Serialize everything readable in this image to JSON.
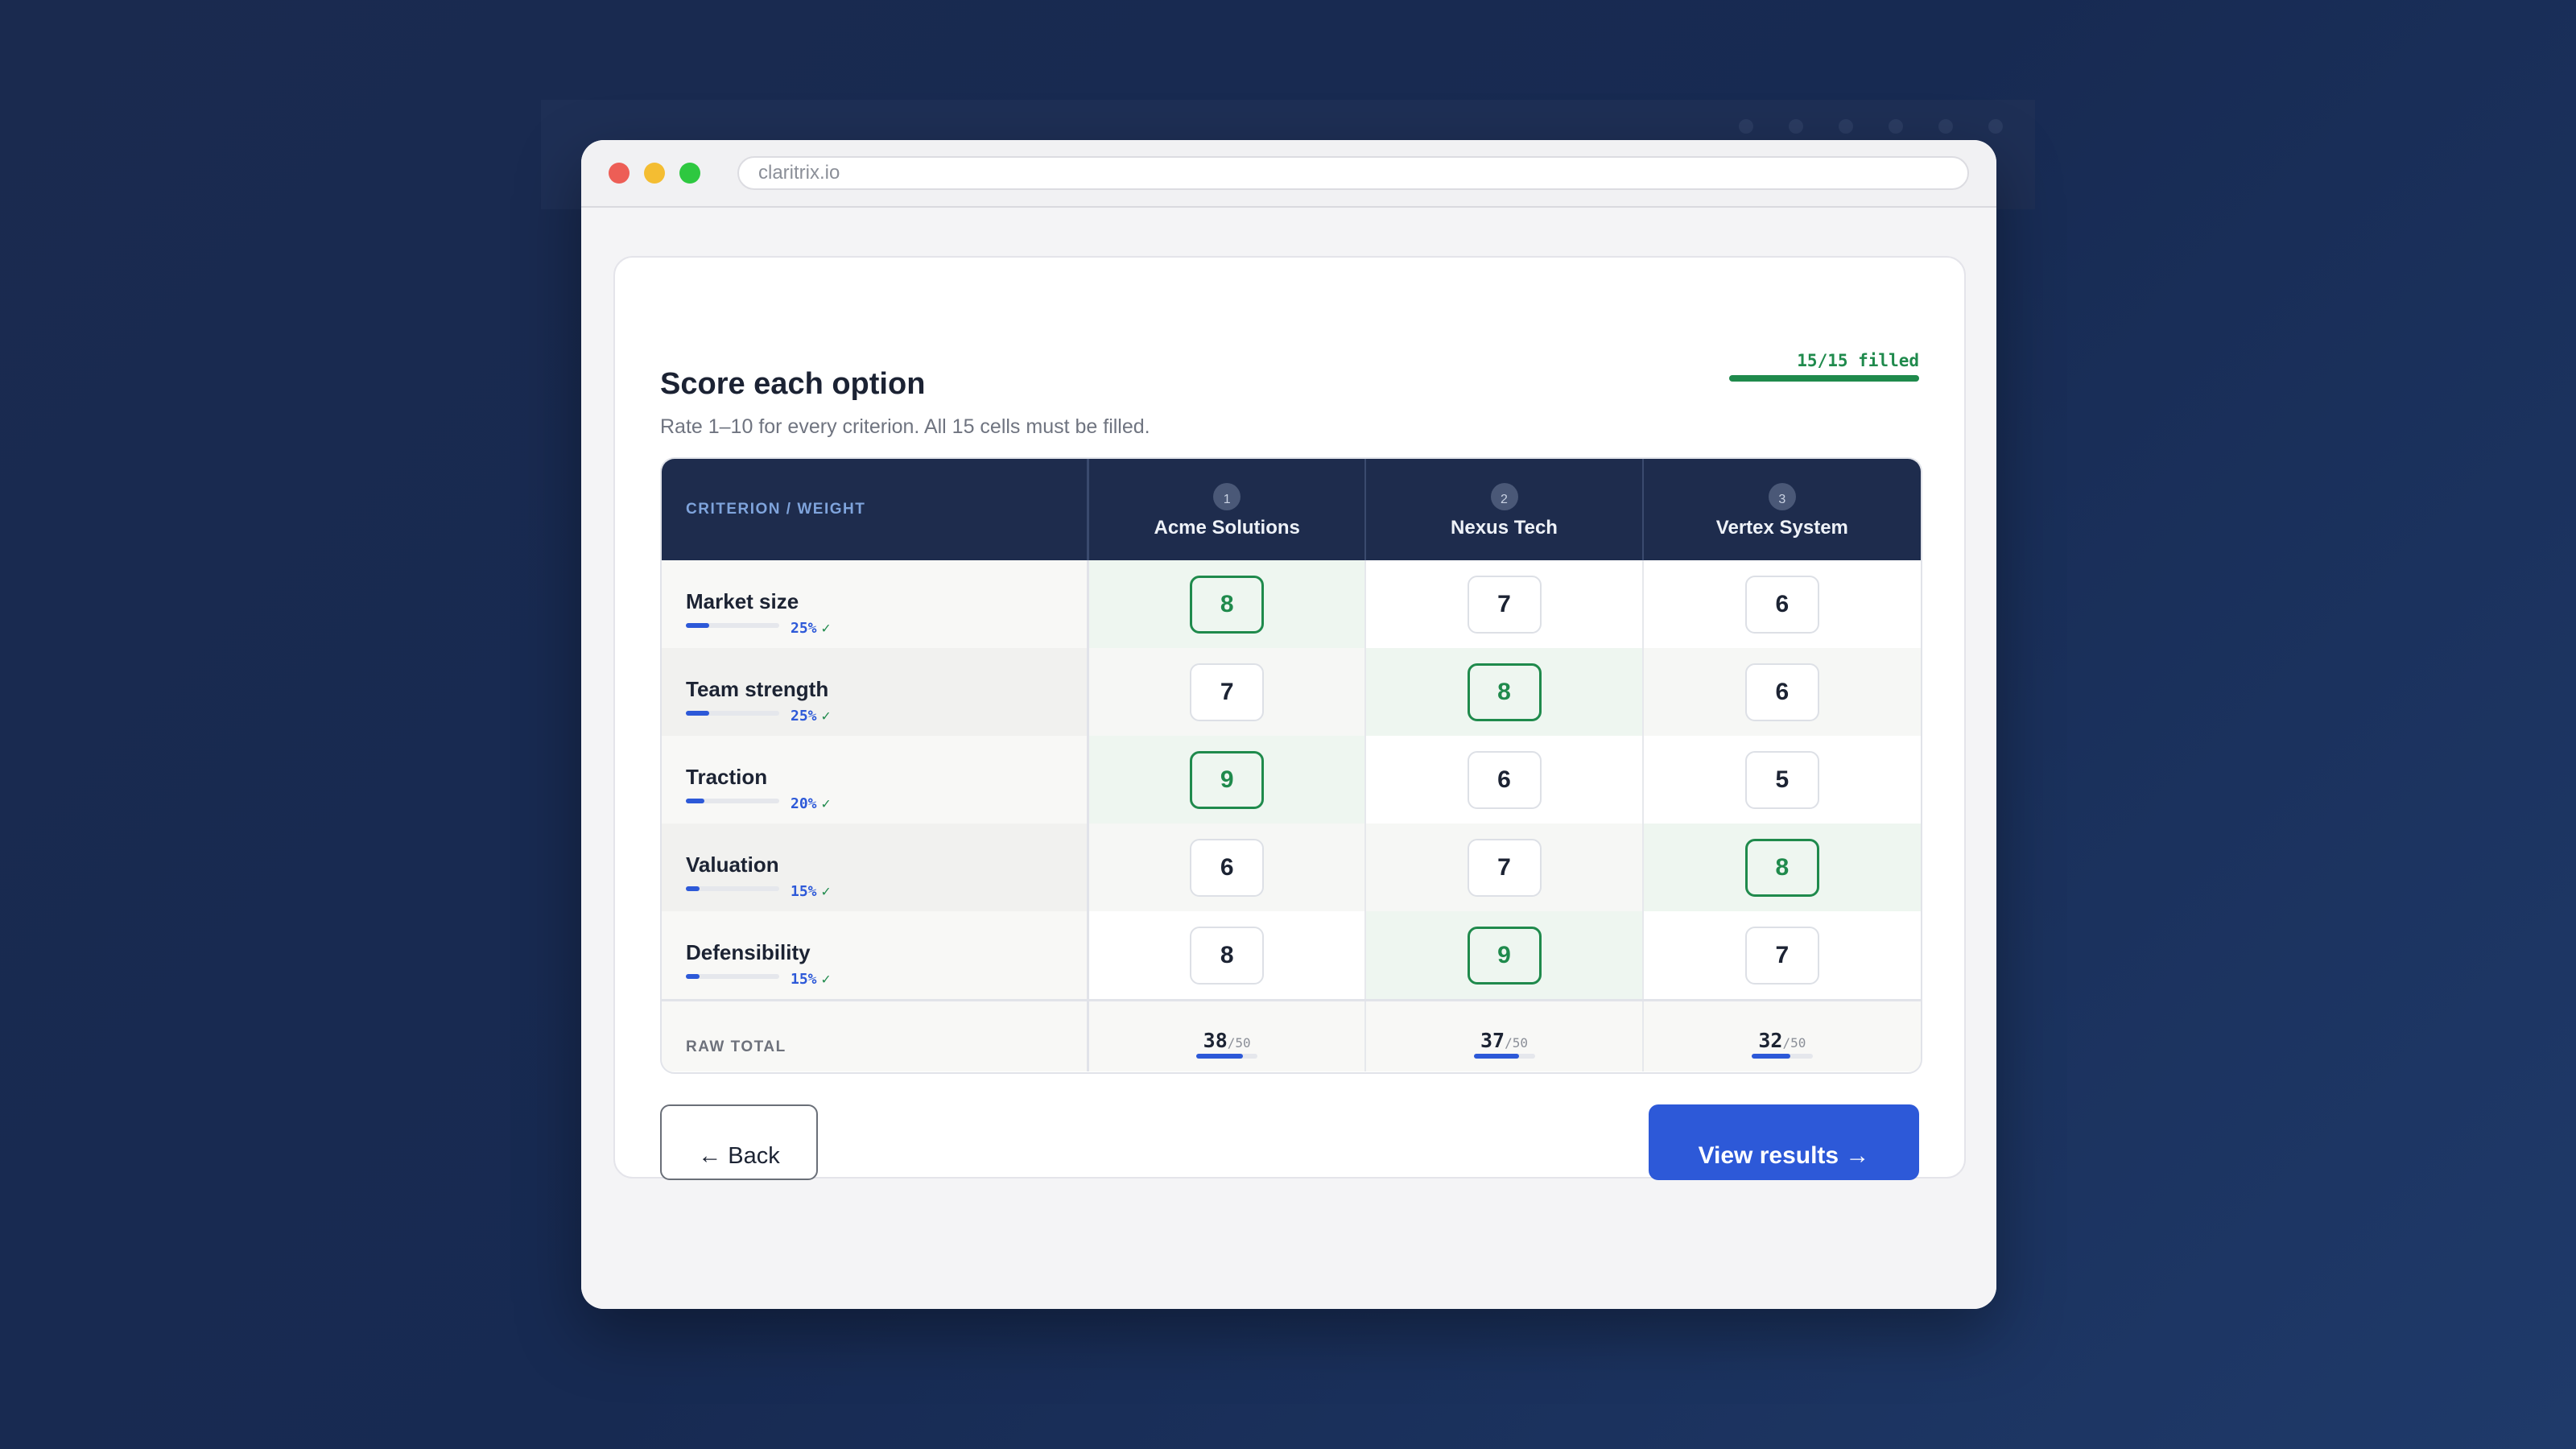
{
  "browser": {
    "url": "claritrix.io"
  },
  "page": {
    "title": "Score each option",
    "subtitle": "Rate 1–10 for every criterion. All 15 cells must be filled.",
    "progress": {
      "label": "15/15 filled",
      "fraction": 1.0
    }
  },
  "table": {
    "criterion_header": "CRITERION / WEIGHT",
    "options": [
      {
        "number": "1",
        "name": "Acme Solutions"
      },
      {
        "number": "2",
        "name": "Nexus Tech"
      },
      {
        "number": "3",
        "name": "Vertex System"
      }
    ],
    "criteria": [
      {
        "name": "Market size",
        "weight_label": "25%",
        "weight": 25,
        "check": "✓",
        "scores": [
          "8",
          "7",
          "6"
        ],
        "best": 0
      },
      {
        "name": "Team strength",
        "weight_label": "25%",
        "weight": 25,
        "check": "✓",
        "scores": [
          "7",
          "8",
          "6"
        ],
        "best": 1
      },
      {
        "name": "Traction",
        "weight_label": "20%",
        "weight": 20,
        "check": "✓",
        "scores": [
          "9",
          "6",
          "5"
        ],
        "best": 0
      },
      {
        "name": "Valuation",
        "weight_label": "15%",
        "weight": 15,
        "check": "✓",
        "scores": [
          "6",
          "7",
          "8"
        ],
        "best": 2
      },
      {
        "name": "Defensibility",
        "weight_label": "15%",
        "weight": 15,
        "check": "✓",
        "scores": [
          "8",
          "9",
          "7"
        ],
        "best": 1
      }
    ],
    "total_label": "RAW TOTAL",
    "totals": [
      {
        "value": "38",
        "max": "/50",
        "fraction": 0.76
      },
      {
        "value": "37",
        "max": "/50",
        "fraction": 0.74
      },
      {
        "value": "32",
        "max": "/50",
        "fraction": 0.64
      }
    ]
  },
  "actions": {
    "back_label": "← Back",
    "results_label": "View results →"
  },
  "colors": {
    "accent": "#2d59d8",
    "success": "#1f8a4c",
    "header_bg": "#1e2c4d"
  }
}
